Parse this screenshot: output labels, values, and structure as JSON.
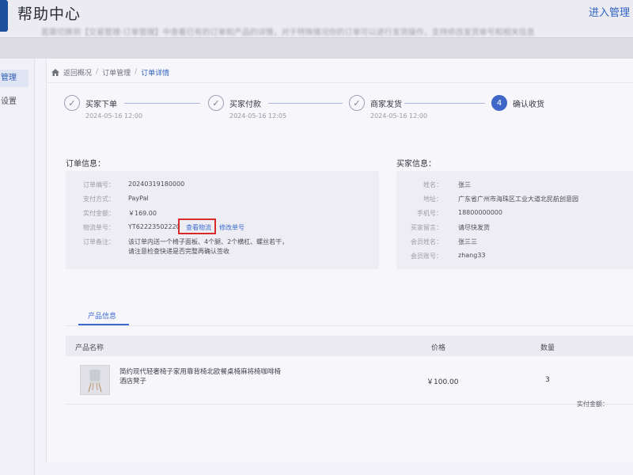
{
  "header": {
    "title": "帮助中心",
    "enter_link": "进入管理"
  },
  "hint_text": "若需切换到【交易管理-订单管理】中查看已有的订单和产品的详情，对于特殊情况你的订单可以进行发货操作，支持修改发货单号和相关信息",
  "sidebar": {
    "items": [
      {
        "label": "管理",
        "active": true
      },
      {
        "label": "设置",
        "active": false
      }
    ]
  },
  "breadcrumb": {
    "home": "返回概况",
    "middle": "订单管理",
    "current": "订单详情"
  },
  "steps": [
    {
      "label": "买家下单",
      "time": "2024-05-16 12:00",
      "status": "done",
      "number": ""
    },
    {
      "label": "买家付款",
      "time": "2024-05-16 12:05",
      "status": "done",
      "number": ""
    },
    {
      "label": "商家发货",
      "time": "2024-05-16 12:00",
      "status": "done",
      "number": ""
    },
    {
      "label": "确认收货",
      "time": "",
      "status": "current",
      "number": "4"
    }
  ],
  "order_info": {
    "title": "订单信息：",
    "rows": [
      {
        "key": "订单编号：",
        "value": "20240319180000"
      },
      {
        "key": "支付方式：",
        "value": "PayPal"
      },
      {
        "key": "实付金额：",
        "value": "￥169.00"
      },
      {
        "key": "物流单号：",
        "value": "YT62223502220"
      }
    ],
    "view_logistics": "查看物流",
    "edit_tracking": "修改单号",
    "note_key": "订单备注：",
    "note_value": "该订单内送一个椅子面板、4个腿、2个横杠、螺丝若干，请注意检查快递是否完整再确认签收"
  },
  "buyer_info": {
    "title": "买家信息：",
    "rows": [
      {
        "key": "姓名：",
        "value": "张三"
      },
      {
        "key": "地址：",
        "value": "广东省广州市海珠区工业大道北民航创意园"
      },
      {
        "key": "手机号：",
        "value": "18800000000"
      },
      {
        "key": "买家留言：",
        "value": "请尽快发货"
      },
      {
        "key": "会员姓名：",
        "value": "张三三"
      },
      {
        "key": "会员账号：",
        "value": "zhang33"
      }
    ]
  },
  "tabs": {
    "product_info": "产品信息"
  },
  "product_table": {
    "headers": {
      "name": "产品名称",
      "price": "价格",
      "quantity": "数量"
    },
    "rows": [
      {
        "name": "简约现代轻奢椅子家用靠背椅北欧餐桌椅麻将椅咖啡椅酒店凳子",
        "price": "￥100.00",
        "quantity": "3"
      }
    ],
    "total_label": "实付金额："
  },
  "colors": {
    "accent": "#3c6ad1",
    "highlight": "#d62b2b",
    "header_bg": "#ecebf1"
  }
}
